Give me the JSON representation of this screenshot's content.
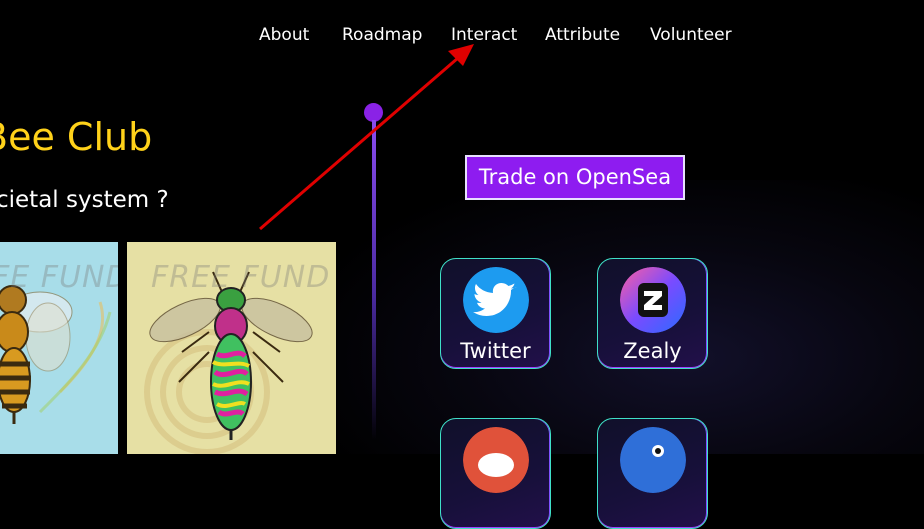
{
  "nav": {
    "items": [
      {
        "label": "About"
      },
      {
        "label": "Roadmap"
      },
      {
        "label": "Interact"
      },
      {
        "label": "Attribute"
      },
      {
        "label": "Volunteer"
      }
    ]
  },
  "hero": {
    "title": "Bee Club",
    "subtitle": "cietal system ?"
  },
  "gallery": {
    "items": [
      {
        "watermark": "FE FUND"
      },
      {
        "watermark": "FREE FUND"
      }
    ]
  },
  "actions": {
    "opensea_label": "Trade on OpenSea"
  },
  "socials": {
    "items": [
      {
        "label": "Twitter",
        "icon": "twitter-icon"
      },
      {
        "label": "Zealy",
        "icon": "zealy-icon"
      },
      {
        "label": "",
        "icon": "red-social-icon"
      },
      {
        "label": "",
        "icon": "blue-social-icon"
      }
    ]
  },
  "colors": {
    "title": "#ffd21a",
    "button": "#8e1cf0",
    "twitter": "#1d9bf0",
    "annotation_arrow": "#e00000"
  }
}
